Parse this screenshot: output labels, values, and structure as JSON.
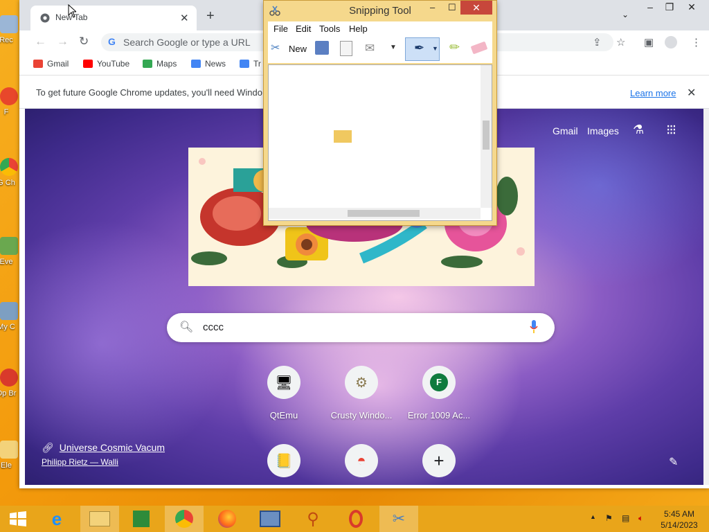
{
  "desktop": {
    "icons": [
      {
        "label": "Rec",
        "color": "#9bb6d6"
      },
      {
        "label": "F",
        "color": "#e8472b"
      },
      {
        "label": "G Ch",
        "color": "#34a853"
      },
      {
        "label": "Eve",
        "color": "#6aa84f"
      },
      {
        "label": "My C",
        "color": "#7d9fc2"
      },
      {
        "label": "Op Br",
        "color": "#d93a2b"
      },
      {
        "label": "Ele",
        "color": "#f3d27a"
      }
    ]
  },
  "chrome": {
    "tab_title": "New Tab",
    "tab_close": "✕",
    "new_tab": "+",
    "omnibox_placeholder": "Search Google or type a URL",
    "bookmarks": [
      {
        "label": "Gmail",
        "color": "#ea4335"
      },
      {
        "label": "YouTube",
        "color": "#ff0000"
      },
      {
        "label": "Maps",
        "color": "#34a853"
      },
      {
        "label": "News",
        "color": "#4285f4"
      },
      {
        "label": "Tr",
        "color": "#4285f4"
      }
    ],
    "infobar_text": "To get future Google Chrome updates, you'll need Windo",
    "infobar_link": "Learn more",
    "ntp": {
      "gmail": "Gmail",
      "images": "Images",
      "search_query": "cccc",
      "tiles": [
        {
          "label": "QtEmu",
          "glyph": "🖥"
        },
        {
          "label": "Crusty Windo...",
          "glyph": "⚙"
        },
        {
          "label": "Error 1009 Ac...",
          "glyph": "F"
        }
      ],
      "tiles_row2": [
        {
          "label": "",
          "glyph": "📒"
        },
        {
          "label": "",
          "glyph": "◓"
        },
        {
          "label": "",
          "glyph": "+"
        }
      ],
      "attribution_title": "Universe Cosmic Vacum",
      "attribution_author": "Philipp Rietz — Walli"
    }
  },
  "snipping_tool": {
    "title": "Snipping Tool",
    "menus": [
      "File",
      "Edit",
      "Tools",
      "Help"
    ],
    "new_label": "New"
  },
  "taskbar": {
    "time": "5:45 AM",
    "date": "5/14/2023"
  }
}
